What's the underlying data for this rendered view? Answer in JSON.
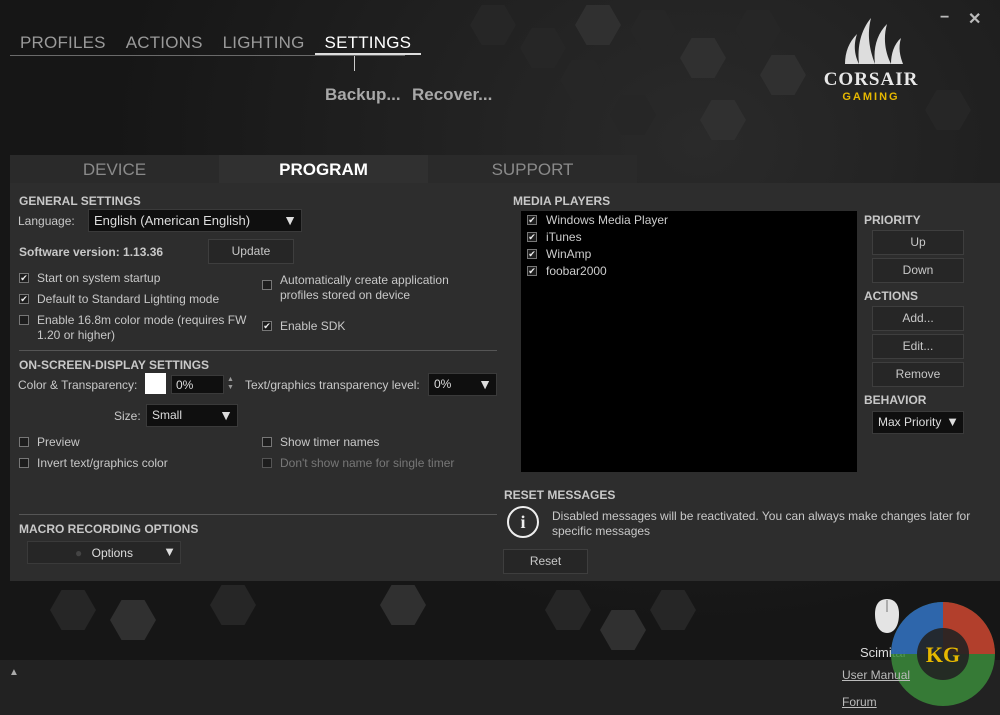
{
  "nav": {
    "tabs": [
      "PROFILES",
      "ACTIONS",
      "LIGHTING",
      "SETTINGS"
    ],
    "sub_links": [
      "Backup...",
      "Recover..."
    ]
  },
  "window": {
    "minimize": "−",
    "close": "✕"
  },
  "logo": {
    "brand": "CORSAIR",
    "tagline": "GAMING"
  },
  "settings_tabs": [
    "DEVICE",
    "PROGRAM",
    "SUPPORT"
  ],
  "general": {
    "title": "GENERAL SETTINGS",
    "language_label": "Language:",
    "language_value": "English (American English)",
    "version_text": "Software version: 1.13.36",
    "update_button": "Update",
    "options": [
      {
        "label": "Start on system startup",
        "checked": true
      },
      {
        "label": "Default to Standard Lighting mode",
        "checked": true
      },
      {
        "label": "Enable 16.8m color mode (requires FW 1.20 or higher)",
        "checked": false
      },
      {
        "label": "Automatically create application profiles stored on device",
        "checked": false
      },
      {
        "label": "Enable SDK",
        "checked": true
      }
    ]
  },
  "osd": {
    "title": "ON-SCREEN-DISPLAY SETTINGS",
    "color_label": "Color & Transparency:",
    "transparency_value": "0%",
    "text_transparency_label": "Text/graphics transparency level:",
    "text_transparency_value": "0%",
    "size_label": "Size:",
    "size_value": "Small",
    "options": [
      {
        "label": "Preview",
        "checked": false
      },
      {
        "label": "Invert text/graphics color",
        "checked": false
      },
      {
        "label": "Show timer names",
        "checked": false
      },
      {
        "label": "Don't show name for single timer",
        "checked": false,
        "disabled": true
      }
    ]
  },
  "macro": {
    "title": "MACRO RECORDING OPTIONS",
    "options_button": "Options"
  },
  "media": {
    "title": "MEDIA PLAYERS",
    "players": [
      "Windows Media Player",
      "iTunes",
      "WinAmp",
      "foobar2000"
    ]
  },
  "priority": {
    "title": "PRIORITY",
    "up": "Up",
    "down": "Down"
  },
  "actions": {
    "title": "ACTIONS",
    "add": "Add...",
    "edit": "Edit...",
    "remove": "Remove"
  },
  "behavior": {
    "title": "BEHAVIOR",
    "value": "Max Priority"
  },
  "reset": {
    "title": "RESET MESSAGES",
    "message": "Disabled messages will be reactivated. You can always make changes later for specific messages",
    "button": "Reset"
  },
  "device": {
    "name": "Scimitar"
  },
  "footer": {
    "manual": "User Manual",
    "forum": "Forum",
    "expand": "▲"
  },
  "colors": {
    "accent": "#e6b800",
    "panel": "#2d2d2d",
    "bg": "#1a1a1a"
  }
}
